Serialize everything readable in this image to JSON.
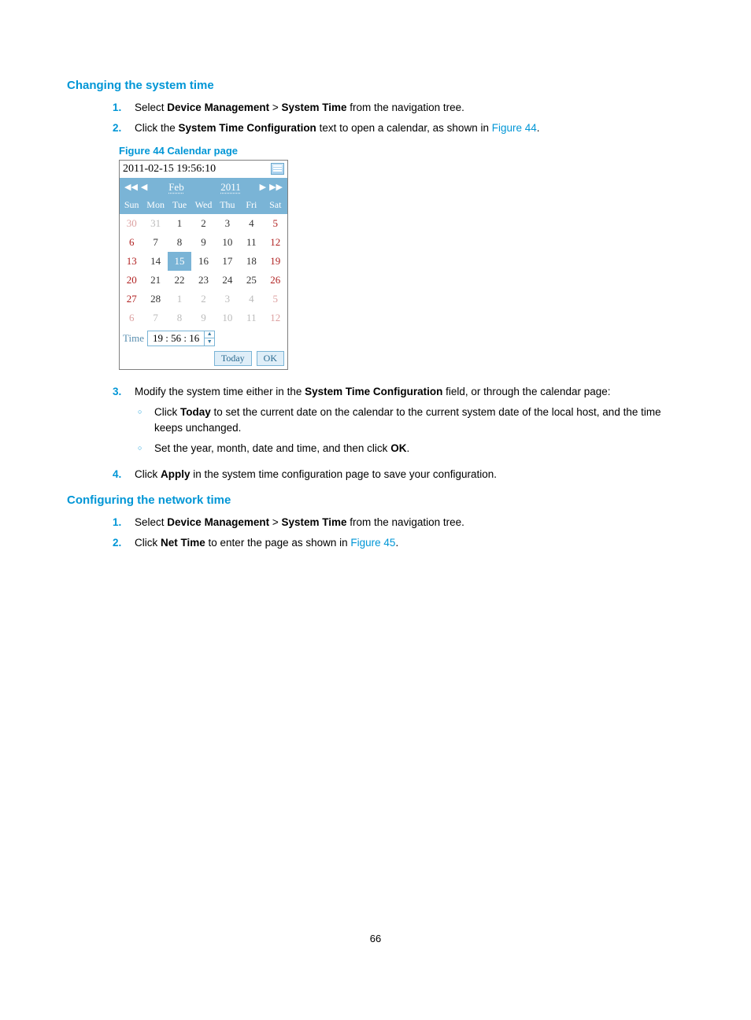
{
  "page_number": "66",
  "section1": {
    "heading": "Changing the system time",
    "steps": [
      {
        "num": "1.",
        "text_prefix": "Select ",
        "b1": "Device Management",
        "sep": " > ",
        "b2": "System Time",
        "text_suffix": " from the navigation tree."
      },
      {
        "num": "2.",
        "text_prefix": "Click the ",
        "b1": "System Time Configuration",
        "text_mid": " text to open a calendar, as shown in ",
        "link": "Figure 44",
        "text_suffix": "."
      },
      {
        "num": "3.",
        "text_prefix": "Modify the system time either in the ",
        "b1": "System Time Configuration",
        "text_suffix": " field, or through the calendar page:",
        "sub": [
          {
            "pre": "Click ",
            "b": "Today",
            "post": " to set the current date on the calendar to the current system date of the local host, and the time keeps unchanged."
          },
          {
            "pre": "Set the year, month, date and time, and then click ",
            "b": "OK",
            "post": "."
          }
        ]
      },
      {
        "num": "4.",
        "text_prefix": "Click ",
        "b1": "Apply",
        "text_suffix": " in the system time configuration page to save your configuration."
      }
    ],
    "figure_title": "Figure 44 Calendar page"
  },
  "section2": {
    "heading": "Configuring the network time",
    "steps": [
      {
        "num": "1.",
        "text_prefix": "Select ",
        "b1": "Device Management",
        "sep": " > ",
        "b2": "System Time",
        "text_suffix": " from the navigation tree."
      },
      {
        "num": "2.",
        "text_prefix": "Click ",
        "b1": "Net Time",
        "text_mid": " to enter the page as shown in ",
        "link": "Figure 45",
        "text_suffix": "."
      }
    ]
  },
  "calendar": {
    "timestamp": "2011-02-15  19:56:10",
    "month": "Feb",
    "year": "2011",
    "dow": [
      "Sun",
      "Mon",
      "Tue",
      "Wed",
      "Thu",
      "Fri",
      "Sat"
    ],
    "rows": [
      [
        {
          "v": "30",
          "c": "muted sun"
        },
        {
          "v": "31",
          "c": "muted"
        },
        {
          "v": "1"
        },
        {
          "v": "2"
        },
        {
          "v": "3"
        },
        {
          "v": "4"
        },
        {
          "v": "5",
          "c": "sat"
        }
      ],
      [
        {
          "v": "6",
          "c": "sun"
        },
        {
          "v": "7"
        },
        {
          "v": "8"
        },
        {
          "v": "9"
        },
        {
          "v": "10"
        },
        {
          "v": "11"
        },
        {
          "v": "12",
          "c": "sat"
        }
      ],
      [
        {
          "v": "13",
          "c": "sun"
        },
        {
          "v": "14"
        },
        {
          "v": "15",
          "c": "sel"
        },
        {
          "v": "16"
        },
        {
          "v": "17"
        },
        {
          "v": "18"
        },
        {
          "v": "19",
          "c": "sat"
        }
      ],
      [
        {
          "v": "20",
          "c": "sun"
        },
        {
          "v": "21"
        },
        {
          "v": "22"
        },
        {
          "v": "23"
        },
        {
          "v": "24"
        },
        {
          "v": "25"
        },
        {
          "v": "26",
          "c": "sat"
        }
      ],
      [
        {
          "v": "27",
          "c": "sun"
        },
        {
          "v": "28"
        },
        {
          "v": "1",
          "c": "muted"
        },
        {
          "v": "2",
          "c": "muted"
        },
        {
          "v": "3",
          "c": "muted"
        },
        {
          "v": "4",
          "c": "muted"
        },
        {
          "v": "5",
          "c": "muted sat"
        }
      ],
      [
        {
          "v": "6",
          "c": "muted sun"
        },
        {
          "v": "7",
          "c": "muted"
        },
        {
          "v": "8",
          "c": "muted"
        },
        {
          "v": "9",
          "c": "muted"
        },
        {
          "v": "10",
          "c": "muted"
        },
        {
          "v": "11",
          "c": "muted"
        },
        {
          "v": "12",
          "c": "muted sat"
        }
      ]
    ],
    "time_label": "Time",
    "time_value": "19 : 56 : 16",
    "today_btn": "Today",
    "ok_btn": "OK"
  }
}
